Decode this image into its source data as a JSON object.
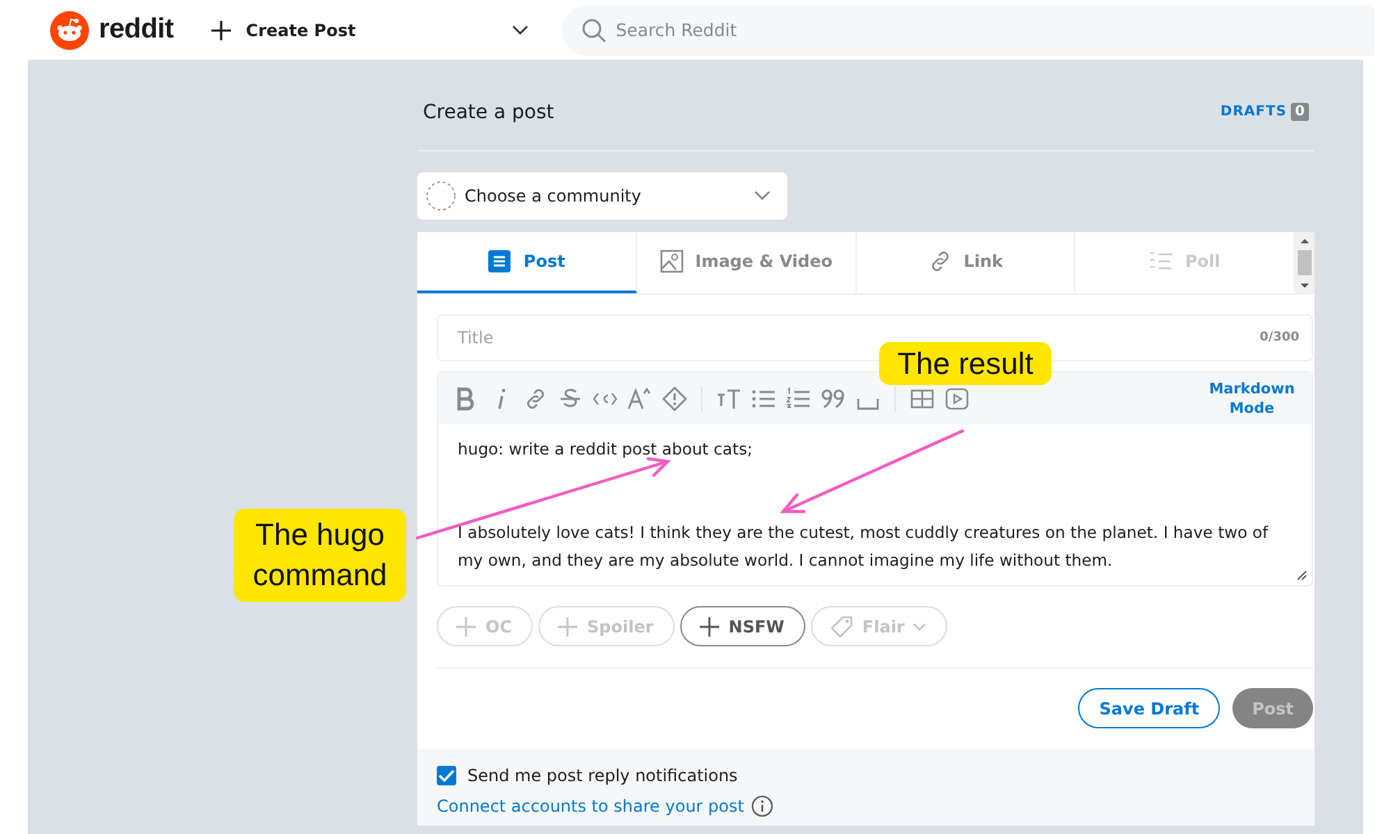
{
  "header": {
    "logo_text": "reddit",
    "create_post": "Create Post",
    "search_placeholder": "Search Reddit"
  },
  "page": {
    "title": "Create a post",
    "drafts_label": "DRAFTS",
    "drafts_count": "0"
  },
  "community_select": {
    "placeholder": "Choose a community"
  },
  "tabs": [
    {
      "kind": "post",
      "label": "Post",
      "selected": true,
      "disabled": false
    },
    {
      "kind": "image",
      "label": "Image & Video",
      "selected": false,
      "disabled": false
    },
    {
      "kind": "link",
      "label": "Link",
      "selected": false,
      "disabled": false
    },
    {
      "kind": "poll",
      "label": "Poll",
      "selected": false,
      "disabled": true
    }
  ],
  "title_field": {
    "placeholder": "Title",
    "counter": "0/300"
  },
  "editor": {
    "toolbar": [
      {
        "kind": "bold"
      },
      {
        "kind": "italic"
      },
      {
        "kind": "link"
      },
      {
        "kind": "strike"
      },
      {
        "kind": "code"
      },
      {
        "kind": "superscript"
      },
      {
        "kind": "spoiler"
      },
      {
        "kind": "separator"
      },
      {
        "kind": "heading"
      },
      {
        "kind": "bullets"
      },
      {
        "kind": "numbers"
      },
      {
        "kind": "quote"
      },
      {
        "kind": "codeblock"
      },
      {
        "kind": "separator"
      },
      {
        "kind": "table"
      },
      {
        "kind": "video"
      }
    ],
    "markdown_mode": "Markdown Mode",
    "paragraphs": [
      {
        "kind": "text",
        "text": "hugo: write a reddit post about cats;"
      },
      {
        "kind": "blank"
      },
      {
        "kind": "text",
        "text": "I absolutely love cats! I think they are the cutest, most cuddly creatures on the planet. I have two of my own, and they are my absolute world. I cannot imagine my life without them."
      }
    ]
  },
  "tags": [
    {
      "kind": "plus",
      "label": "OC",
      "disabled": true
    },
    {
      "kind": "plus",
      "label": "Spoiler",
      "disabled": true
    },
    {
      "kind": "plus",
      "label": "NSFW",
      "disabled": false
    },
    {
      "kind": "flair",
      "label": "Flair",
      "disabled": true
    }
  ],
  "buttons": [
    {
      "kind": "outline",
      "label": "Save Draft",
      "disabled": false
    },
    {
      "kind": "solid",
      "label": "Post",
      "disabled": true
    }
  ],
  "notifications": {
    "label": "Send me post reply notifications",
    "checked": true
  },
  "connect_link": "Connect accounts to share your post",
  "callouts": [
    {
      "kind": "result",
      "text": "The result"
    },
    {
      "kind": "command",
      "text": "The hugo command"
    }
  ]
}
